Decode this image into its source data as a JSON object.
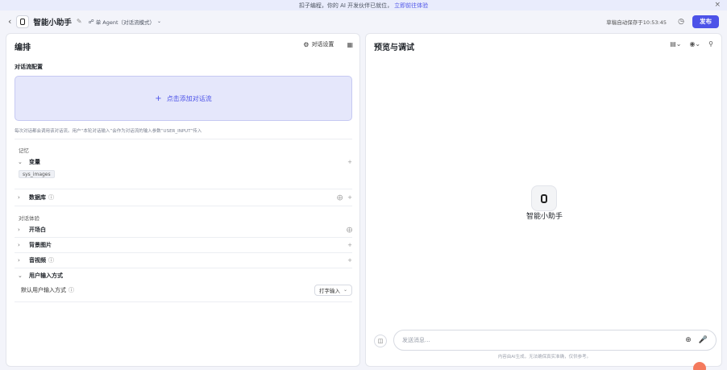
{
  "banner": {
    "text": "扣子编程，你的 AI 开发伙伴已就位，",
    "link": "立即前往体验",
    "close_icon": "×"
  },
  "topbar": {
    "back_icon": "chevron-left-icon",
    "app_name": "智能小助手",
    "mode_label": "单 Agent（对话流模式）",
    "autosave": "草稿自动保存于10:53:45",
    "publish_label": "发布"
  },
  "left": {
    "title": "编排",
    "dialog_settings_label": "对话设置",
    "flow_config_title": "对话流配置",
    "add_flow_label": "点击添加对话流",
    "hint": "每次对话都会调用该对话流。用户“本轮对话输入”会作为对话流的输入参数“USER_INPUT”传入",
    "memory_label": "记忆",
    "variable_label": "变量",
    "variable_tag": "sys_images",
    "database_label": "数据库",
    "experience_label": "对话体验",
    "opening_label": "开场白",
    "background_label": "背景图片",
    "audio_video_label": "音视频",
    "user_input_label": "用户输入方式",
    "default_input_label": "默认用户输入方式",
    "input_mode_value": "打字输入"
  },
  "right": {
    "title": "预览与调试",
    "bot_name": "智能小助手",
    "message_placeholder": "发送消息...",
    "disclaimer": "内容由AI生成，无法确保真实准确，仅供参考。"
  },
  "colors": {
    "accent": "#4d53e8",
    "add_flow_bg": "#e5e7fb",
    "banner_bg": "#e9ecfc",
    "float_button": "#f47a5d"
  }
}
